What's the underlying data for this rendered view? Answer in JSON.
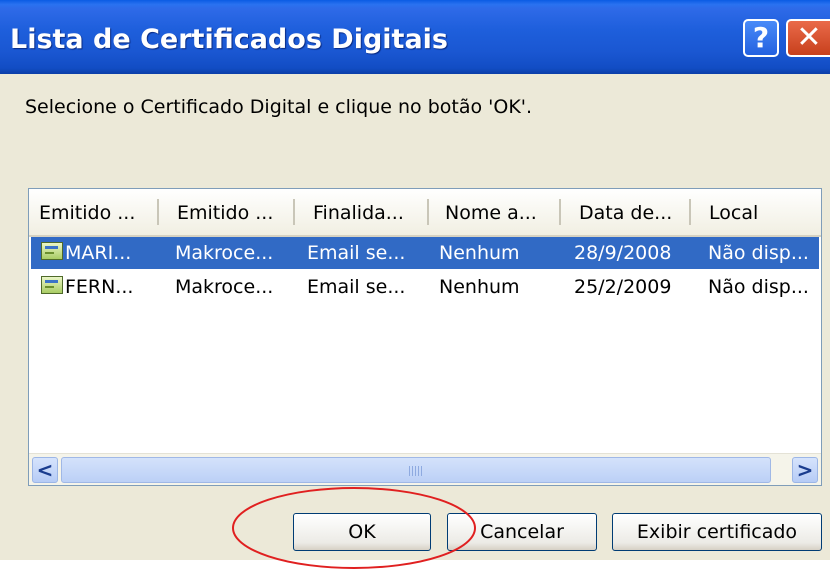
{
  "window": {
    "title": "Lista de Certificados Digitais",
    "help_glyph": "?",
    "close_glyph": "✕"
  },
  "instruction": "Selecione o Certificado Digital e clique no botão 'OK'.",
  "list": {
    "columns": [
      "Emitido ...",
      "Emitido ...",
      "Finalida...",
      "Nome a...",
      "Data de...",
      "Local"
    ],
    "rows": [
      {
        "issued_to": "MARI...",
        "issued_by": "Makroce...",
        "purpose": "Email se...",
        "friendly_name": "Nenhum",
        "date": "28/9/2008",
        "location": "Não disp...",
        "selected": true,
        "icon": "certificate-icon"
      },
      {
        "issued_to": "FERN...",
        "issued_by": "Makroce...",
        "purpose": "Email se...",
        "friendly_name": "Nenhum",
        "date": "25/2/2009",
        "location": "Não disp...",
        "selected": false,
        "icon": "certificate-icon"
      }
    ]
  },
  "scrollbar": {
    "left_arrow": "<",
    "right_arrow": ">"
  },
  "buttons": {
    "ok": "OK",
    "cancel": "Cancelar",
    "view_certificate": "Exibir certificado"
  },
  "colors": {
    "selection": "#316ac5",
    "title_bar": "#1a57d2",
    "annotation_ellipse": "#e02020"
  }
}
